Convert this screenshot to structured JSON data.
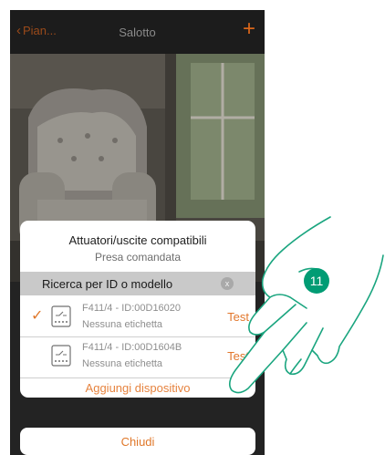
{
  "header": {
    "back_label": "Pian...",
    "title": "Salotto",
    "add_symbol": "+"
  },
  "dialog": {
    "title": "Attuatori/uscite compatibili",
    "subtitle": "Presa comandata",
    "search": {
      "label": "Ricerca per ID o modello",
      "clear_symbol": "x"
    },
    "devices": [
      {
        "name": "F411/4 - ID:00D16020",
        "label": "Nessuna etichetta",
        "action": "Test",
        "selected": true
      },
      {
        "name": "F411/4 - ID:00D1604B",
        "label": "Nessuna etichetta",
        "action": "Test",
        "selected": false
      }
    ],
    "add_button": "Aggiungi dispositivo"
  },
  "close_button": "Chiudi",
  "step_badge": "11",
  "colors": {
    "accent": "#e0782a",
    "step_badge": "#009c74",
    "app_background": "#2b2b2b"
  }
}
